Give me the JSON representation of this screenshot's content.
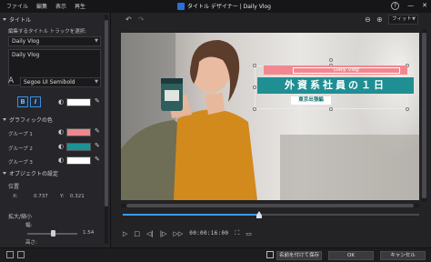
{
  "menu": [
    "ファイル",
    "編集",
    "表示",
    "再生"
  ],
  "app_title": "タイトル デザイナー | Daily Vlog",
  "window_buttons": {
    "help": "?",
    "minimize": "—",
    "close": "✕"
  },
  "left_panel": {
    "title_section": "タイトル",
    "track_select_label": "編集するタイトル トラックを選択:",
    "track_select_value": "Daily Vlog",
    "text_value": "Daily Vlog",
    "font_value": "Segoe UI Semibold",
    "bold_label": "B",
    "italic_label": "I",
    "graphics_color_section": "グラフィックの色",
    "groups": [
      {
        "label": "グループ 1",
        "color": "#f0878e"
      },
      {
        "label": "グループ 2",
        "color": "#1d9297"
      },
      {
        "label": "グループ 3",
        "color": "#ffffff"
      }
    ],
    "object_settings_section": "オブジェクトの設定",
    "position_label": "位置",
    "x_label": "X:",
    "x_value": "0.737",
    "y_label": "Y:",
    "y_value": "0.321",
    "scale_label": "拡大/縮小",
    "width_label": "幅:",
    "scale_value": "1.54",
    "height_label": "高さ:"
  },
  "toolbar": {
    "fit_label": "フィット"
  },
  "overlay": {
    "pink_text": "Daily Vlog",
    "teal_text": "外資系社員の１日",
    "sub_text": "東京出張編"
  },
  "player": {
    "timecode": "00:00:16:00",
    "progress": 0.46
  },
  "bottom": {
    "save_as": "名前を付けて保存",
    "ok": "OK",
    "cancel": "キャンセル"
  },
  "colors": {
    "accent": "#3a9de8",
    "teal": "#1f8f93",
    "pink": "#f2888f"
  }
}
